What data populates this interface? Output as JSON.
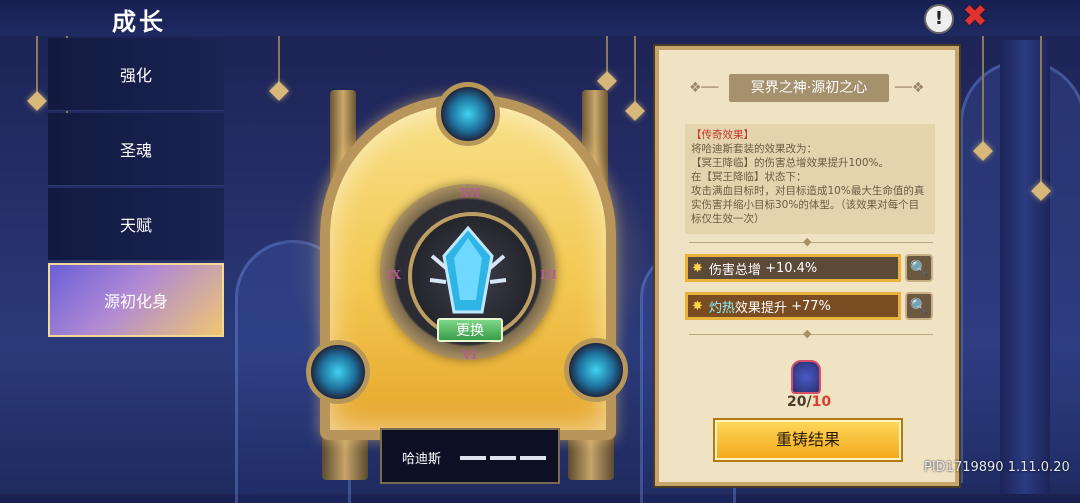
{
  "header": {
    "title": "成长"
  },
  "menu": {
    "items": [
      {
        "label": "强化"
      },
      {
        "label": "圣魂"
      },
      {
        "label": "天赋"
      },
      {
        "label": "源初化身"
      }
    ]
  },
  "artifact": {
    "swap_label": "更换",
    "numerals": {
      "top": "XII",
      "left": "IX",
      "right": "III",
      "bottom": "VI"
    },
    "character_name": "哈迪斯"
  },
  "panel": {
    "title": "冥界之神·源初之心",
    "legend_label": "【传奇效果】",
    "legend_text": "将哈迪斯套装的效果改为：\n【冥王降临】的伤害总增效果提升100%。\n在【冥王降临】状态下：\n攻击满血目标时，对目标造成10%最大生命值的真实伤害并缩小目标30%的体型。（该效果对每个目标仅生效一次）",
    "stat1": {
      "label": "伤害总增",
      "value": "+10.4%"
    },
    "stat2": {
      "label_highlight": "灼热",
      "label_rest": "效果提升",
      "value": "+77%"
    },
    "material": {
      "current": "20/",
      "max": "10"
    },
    "reforge_label": "重铸结果"
  },
  "footer": {
    "pid": "PID1719890 1.11.0.20"
  },
  "colors": {
    "accent_gold": "#f2a91a",
    "close_red": "#e0332e",
    "menu_active": "#6a5fd8"
  }
}
